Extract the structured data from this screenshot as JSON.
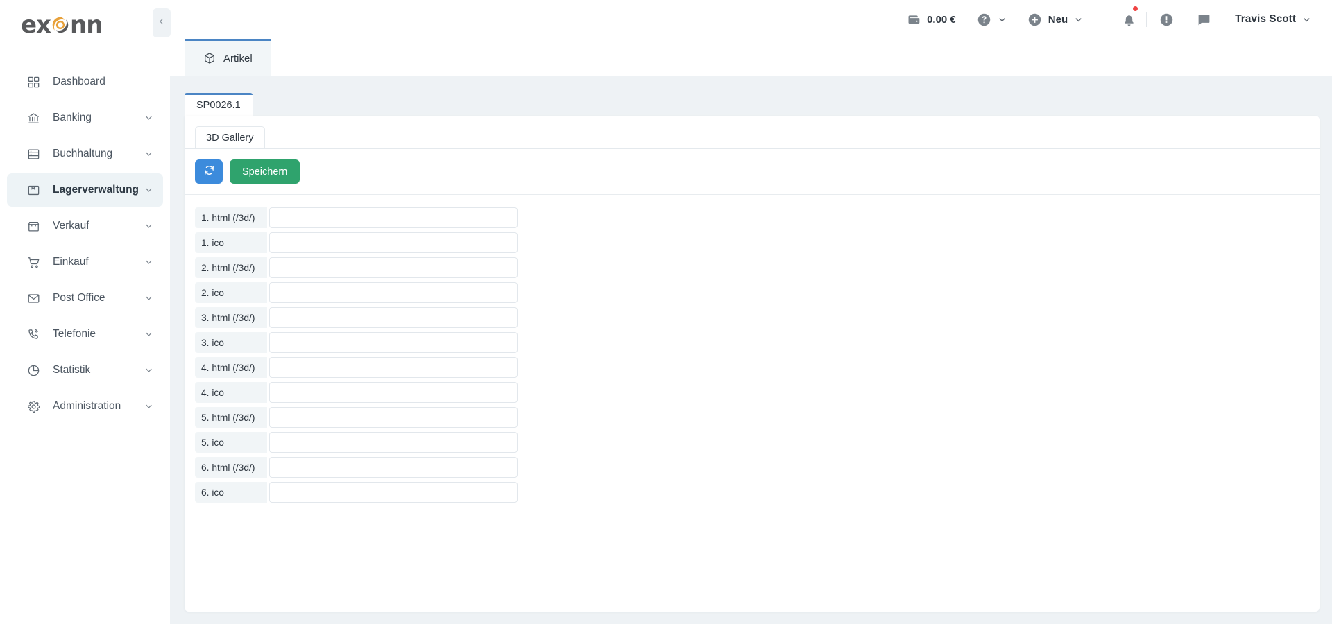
{
  "brand": {
    "logo_text_left": "ex",
    "logo_text_right": "nn",
    "accent_color": "#e8a13a",
    "logo_gray": "#58595b"
  },
  "sidebar": {
    "collapse_icon": "chevron-left-icon",
    "items": [
      {
        "label": "Dashboard",
        "icon": "grid-icon",
        "has_chevron": false,
        "active": false
      },
      {
        "label": "Banking",
        "icon": "bank-icon",
        "has_chevron": true,
        "active": false
      },
      {
        "label": "Buchhaltung",
        "icon": "ledger-icon",
        "has_chevron": true,
        "active": false
      },
      {
        "label": "Lagerverwaltung",
        "icon": "package-icon",
        "has_chevron": true,
        "active": true
      },
      {
        "label": "Verkauf",
        "icon": "store-icon",
        "has_chevron": true,
        "active": false
      },
      {
        "label": "Einkauf",
        "icon": "cart-icon",
        "has_chevron": true,
        "active": false
      },
      {
        "label": "Post Office",
        "icon": "envelope-icon",
        "has_chevron": true,
        "active": false
      },
      {
        "label": "Telefonie",
        "icon": "phone-icon",
        "has_chevron": true,
        "active": false
      },
      {
        "label": "Statistik",
        "icon": "pie-chart-icon",
        "has_chevron": true,
        "active": false
      },
      {
        "label": "Administration",
        "icon": "gear-icon",
        "has_chevron": true,
        "active": false
      }
    ]
  },
  "topbar": {
    "balance": "0.00 €",
    "balance_icon": "wallet-icon",
    "help_icon": "help-circle-icon",
    "new_label": "Neu",
    "new_icon": "plus-circle-icon",
    "notifications_icon": "bell-icon",
    "notifications_has_badge": true,
    "badge_color": "#ef4444",
    "alerts_icon": "exclamation-circle-icon",
    "messages_icon": "chat-bubble-icon",
    "user_name": "Travis Scott",
    "user_chevron": "chevron-down-icon"
  },
  "module_tab": {
    "label": "Artikel",
    "icon": "cube-icon",
    "active_color": "#4b85c4"
  },
  "record_tab": {
    "label": "SP0026.1"
  },
  "inner_tab": {
    "label": "3D Gallery"
  },
  "toolbar": {
    "refresh_label": "",
    "refresh_icon": "refresh-icon",
    "refresh_color": "#3c8bdc",
    "save_label": "Speichern",
    "save_color": "#2fa36d"
  },
  "form": {
    "rows": [
      {
        "label": "1. html (/3d/)",
        "value": ""
      },
      {
        "label": "1. ico",
        "value": ""
      },
      {
        "label": "2. html (/3d/)",
        "value": ""
      },
      {
        "label": "2. ico",
        "value": ""
      },
      {
        "label": "3. html (/3d/)",
        "value": ""
      },
      {
        "label": "3. ico",
        "value": ""
      },
      {
        "label": "4. html (/3d/)",
        "value": ""
      },
      {
        "label": "4. ico",
        "value": ""
      },
      {
        "label": "5. html (/3d/)",
        "value": ""
      },
      {
        "label": "5. ico",
        "value": ""
      },
      {
        "label": "6. html (/3d/)",
        "value": ""
      },
      {
        "label": "6. ico",
        "value": ""
      }
    ]
  }
}
